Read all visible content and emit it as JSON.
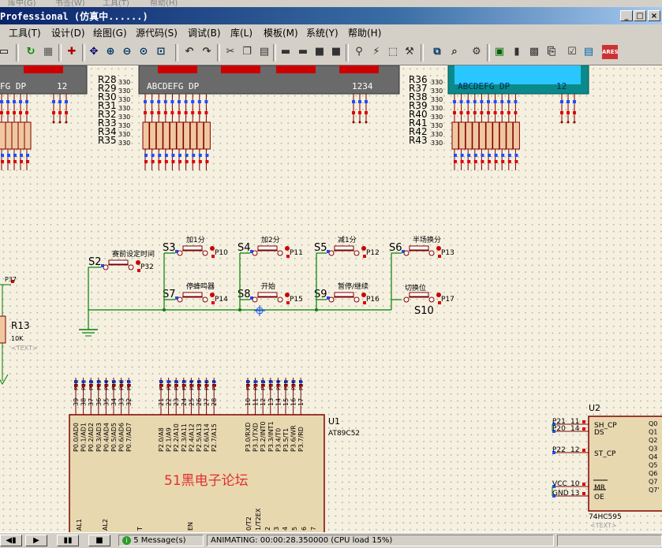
{
  "window": {
    "title": "Professional (仿真中......)",
    "ghost_menu": [
      "库中(G)",
      "书签(W)",
      "工具(T)",
      "帮助(H)"
    ]
  },
  "menu": [
    "工具(T)",
    "设计(D)",
    "绘图(G)",
    "源代码(S)",
    "调试(B)",
    "库(L)",
    "模板(M)",
    "系统(Y)",
    "帮助(H)"
  ],
  "toolbar": {
    "icons": [
      "page-icon",
      "refresh-icon",
      "grid-icon",
      "origin-icon",
      "pan-icon",
      "zoom-in-icon",
      "zoom-out-icon",
      "zoom-all-icon",
      "zoom-area-icon",
      "undo-icon",
      "redo-icon",
      "cut-icon",
      "copy-icon",
      "paste-icon",
      "block-copy-icon",
      "block-move-icon",
      "block-rotate-icon",
      "block-delete-icon",
      "pick-device-icon",
      "make-device-icon",
      "packaging-icon",
      "decompose-icon",
      "wire-autorouter-icon",
      "search-icon",
      "property-icon",
      "new-sheet-icon",
      "remove-sheet-icon",
      "bom-icon",
      "netlist-icon",
      "erc-icon",
      "ares-icon"
    ],
    "ares_label": "ARES"
  },
  "schematic": {
    "display_left": {
      "seg_labels": "FG DP",
      "digits": "12"
    },
    "display_mid": {
      "seg_labels": "ABCDEFG DP",
      "digits": "1234"
    },
    "display_right": {
      "seg_labels": "ABCDEFG DP",
      "digits": "12"
    },
    "resistors_mid": [
      "R28",
      "R29",
      "R30",
      "R31",
      "R32",
      "R33",
      "R34",
      "R35"
    ],
    "resistors_right": [
      "R36",
      "R37",
      "R38",
      "R39",
      "R40",
      "R41",
      "R42",
      "R43"
    ],
    "resistor_value": "330",
    "switches": [
      {
        "ref": "S2",
        "label": "赛前设定时间",
        "port": "P32"
      },
      {
        "ref": "S3",
        "label": "加1分",
        "port": "P10"
      },
      {
        "ref": "S4",
        "label": "加2分",
        "port": "P11"
      },
      {
        "ref": "S5",
        "label": "减1分",
        "port": "P12"
      },
      {
        "ref": "S6",
        "label": "半场换分",
        "port": "P13"
      },
      {
        "ref": "S7",
        "label": "停蜂鸣器",
        "port": "P14"
      },
      {
        "ref": "S8",
        "label": "开始",
        "port": "P15"
      },
      {
        "ref": "S9",
        "label": "暂停/继续",
        "port": "P16"
      },
      {
        "ref": "S10",
        "label": "切换位",
        "port": "P17"
      }
    ],
    "r13": {
      "ref": "R13",
      "value": "10K",
      "text": "<TEXT>",
      "port": "P37"
    },
    "u1": {
      "ref": "U1",
      "part": "AT89C52",
      "watermark": "51黑电子论坛",
      "p0_pins": [
        "39",
        "38",
        "37",
        "36",
        "35",
        "34",
        "33",
        "32"
      ],
      "p0_names": [
        "P0.0/AD0",
        "P0.1/AD1",
        "P0.2/AD2",
        "P0.3/AD3",
        "P0.4/AD4",
        "P0.5/AD5",
        "P0.6/AD6",
        "P0.7/AD7"
      ],
      "p2_pins": [
        "21",
        "22",
        "23",
        "24",
        "25",
        "26",
        "27",
        "28"
      ],
      "p2_names": [
        "P2.0/A8",
        "P2.1/A9",
        "P2.2/A10",
        "P2.3/A11",
        "P2.4/A12",
        "P2.5/A13",
        "P2.6/A14",
        "P2.7/A15"
      ],
      "p3_pins": [
        "10",
        "11",
        "12",
        "13",
        "14",
        "15",
        "16",
        "17"
      ],
      "p3_names": [
        "P3.0/RXD",
        "P3.1/TXD",
        "P3.2/INT0",
        "P3.3/INT1",
        "P3.4/T0",
        "P3.5/T1",
        "P3.6/WR",
        "P3.7/RD"
      ],
      "bottom_labels": [
        "AL1",
        "AL2",
        "T",
        "EN",
        "0/T2",
        "1/T2EX",
        "2",
        "3",
        "4",
        "5",
        "6",
        "7"
      ]
    },
    "u2": {
      "ref": "U2",
      "part": "74HC595",
      "text": "<TEXT>",
      "left_pins": [
        {
          "net": "P21",
          "num": "11",
          "name": "SH_CP"
        },
        {
          "net": "P20",
          "num": "14",
          "name": "DS"
        },
        {
          "net": "P22",
          "num": "12",
          "name": "ST_CP"
        },
        {
          "net": "VCC",
          "num": "10",
          "name": "MR"
        },
        {
          "net": "GND",
          "num": "13",
          "name": "OE"
        }
      ],
      "right_pins": [
        "Q0",
        "Q1",
        "Q2",
        "Q3",
        "Q4",
        "Q5",
        "Q6",
        "Q7",
        "Q7'"
      ]
    }
  },
  "status": {
    "messages": "5 Message(s)",
    "sim": "ANIMATING: 00:00:28.350000 (CPU load 15%)"
  }
}
